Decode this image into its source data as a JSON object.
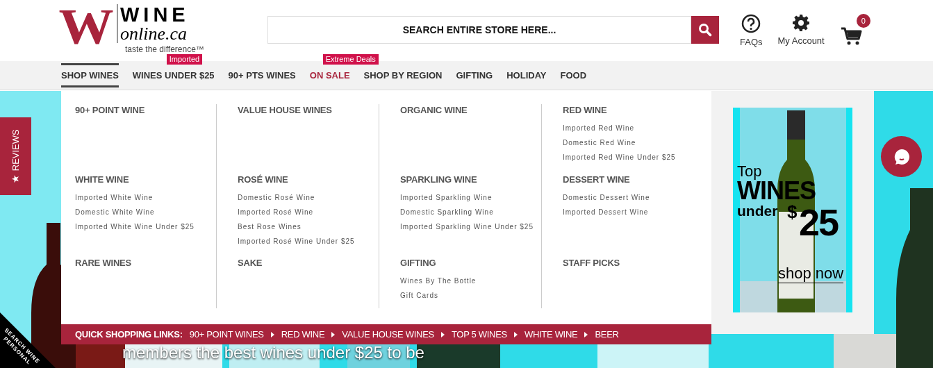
{
  "header": {
    "logo": {
      "mark": "W",
      "wordmark": "WINE",
      "domain": "online.ca",
      "tagline": "taste the difference™"
    },
    "search": {
      "placeholder": "SEARCH ENTIRE STORE HERE..."
    },
    "actions": [
      {
        "kind": "help",
        "label": "FAQs"
      },
      {
        "kind": "account",
        "label": "My Account"
      },
      {
        "kind": "cart",
        "count": "0"
      }
    ]
  },
  "nav": [
    {
      "label": "SHOP WINES",
      "selected": true,
      "highlight": false
    },
    {
      "label": "WINES UNDER $25",
      "selected": false,
      "highlight": false,
      "badge": "Imported"
    },
    {
      "label": "90+ PTS WINES",
      "selected": false,
      "highlight": false
    },
    {
      "label": "ON SALE",
      "selected": false,
      "highlight": true,
      "badge": "Extreme Deals"
    },
    {
      "label": "SHOP BY REGION",
      "selected": false,
      "highlight": false
    },
    {
      "label": "GIFTING",
      "selected": false,
      "highlight": false
    },
    {
      "label": "HOLIDAY",
      "selected": false,
      "highlight": false
    },
    {
      "label": "FOOD",
      "selected": false,
      "highlight": false
    }
  ],
  "mega_menu": {
    "sections": [
      {
        "title": "90+ POINT WINE"
      },
      {
        "title": "VALUE HOUSE WINES"
      },
      {
        "title": "ORGANIC WINE"
      },
      {
        "title": "RED WINE",
        "links": [
          "Imported Red Wine",
          "Domestic Red Wine",
          "Imported Red Wine Under $25"
        ]
      },
      {
        "title": "WHITE WINE",
        "links": [
          "Imported White Wine",
          "Domestic White Wine",
          "Imported White Wine Under $25"
        ]
      },
      {
        "title": "ROSÉ WINE",
        "links": [
          "Domestic Rosé Wine",
          "Imported Rosé Wine",
          "Best Rose Wines",
          "Imported Rosé Wine Under $25"
        ]
      },
      {
        "title": "SPARKLING WINE",
        "links": [
          "Imported Sparkling Wine",
          "Domestic Sparkling Wine",
          "Imported Sparkling Wine Under $25"
        ]
      },
      {
        "title": "DESSERT WINE",
        "links": [
          "Domestic Dessert Wine",
          "Imported Dessert Wine"
        ]
      },
      {
        "title": "RARE WINES"
      },
      {
        "title": "SAKE"
      },
      {
        "title": "GIFTING",
        "links": [
          "Wines By The Bottle",
          "Gift Cards"
        ]
      },
      {
        "title": "STAFF PICKS"
      }
    ],
    "quick_links": {
      "label": "QUICK SHOPPING LINKS:",
      "links": [
        "90+ POINT WINES",
        "RED WINE",
        "VALUE HOUSE WINES",
        "TOP 5 WINES",
        "WHITE WINE",
        "BEER"
      ]
    },
    "promo": {
      "top": "Top",
      "wines": "WINES",
      "under": "under",
      "currency": "$",
      "amount": "25",
      "cta": "shop now"
    }
  },
  "reviews_tab": {
    "label": "REVIEWS"
  },
  "search_ribbon": {
    "lines": [
      "SEARCH WINE",
      "PERSONAL"
    ]
  },
  "hero_text": "members the best wines under $25 to be"
}
